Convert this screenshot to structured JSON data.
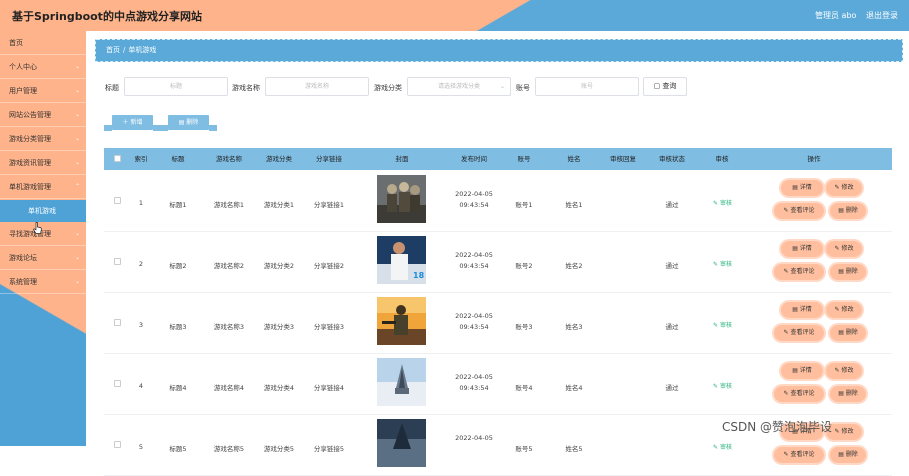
{
  "header": {
    "title": "基于Springboot的中点游戏分享网站",
    "user": "管理员 abo",
    "logout": "退出登录"
  },
  "sidebar": {
    "items": [
      {
        "label": "首页",
        "chevron": ""
      },
      {
        "label": "个人中心",
        "chevron": "⌄"
      },
      {
        "label": "用户管理",
        "chevron": "⌄"
      },
      {
        "label": "网站公告管理",
        "chevron": "⌄"
      },
      {
        "label": "游戏分类管理",
        "chevron": "⌄"
      },
      {
        "label": "游戏资讯管理",
        "chevron": "⌄"
      },
      {
        "label": "单机游戏管理",
        "chevron": "⌃"
      },
      {
        "label": "寻找游戏管理",
        "chevron": "⌄"
      },
      {
        "label": "游戏论坛",
        "chevron": "⌄"
      },
      {
        "label": "系统管理",
        "chevron": "⌄"
      }
    ],
    "active_sub": "单机游戏"
  },
  "breadcrumb": {
    "home": "首页",
    "sep": "/",
    "current": "单机游戏"
  },
  "search": {
    "title_label": "标题",
    "title_placeholder": "标题",
    "name_label": "游戏名称",
    "name_placeholder": "游戏名称",
    "category_label": "游戏分类",
    "category_placeholder": "请选择游戏分类",
    "account_label": "账号",
    "account_placeholder": "账号",
    "button": "查询"
  },
  "actions": {
    "add": "新增",
    "delete": "删除"
  },
  "table": {
    "headers": [
      "索引",
      "标题",
      "游戏名称",
      "游戏分类",
      "分享链接",
      "封面",
      "发布时间",
      "账号",
      "姓名",
      "审核回复",
      "审核状态",
      "审核",
      "操作"
    ],
    "rows": [
      {
        "index": "1",
        "title": "标题1",
        "name": "游戏名称1",
        "category": "游戏分类1",
        "link": "分享链接1",
        "date": "2022-04-05",
        "time": "09:43:54",
        "account": "账号1",
        "person": "姓名1",
        "reply": "",
        "status": "通过"
      },
      {
        "index": "2",
        "title": "标题2",
        "name": "游戏名称2",
        "category": "游戏分类2",
        "link": "分享链接2",
        "date": "2022-04-05",
        "time": "09:43:54",
        "account": "账号2",
        "person": "姓名2",
        "reply": "",
        "status": "通过"
      },
      {
        "index": "3",
        "title": "标题3",
        "name": "游戏名称3",
        "category": "游戏分类3",
        "link": "分享链接3",
        "date": "2022-04-05",
        "time": "09:43:54",
        "account": "账号3",
        "person": "姓名3",
        "reply": "",
        "status": "通过"
      },
      {
        "index": "4",
        "title": "标题4",
        "name": "游戏名称4",
        "category": "游戏分类4",
        "link": "分享链接4",
        "date": "2022-04-05",
        "time": "09:43:54",
        "account": "账号4",
        "person": "姓名4",
        "reply": "",
        "status": "通过"
      },
      {
        "index": "5",
        "title": "标题5",
        "name": "游戏名称5",
        "category": "游戏分类5",
        "link": "分享链接5",
        "date": "2022-04-05",
        "time": "",
        "account": "账号5",
        "person": "姓名5",
        "reply": "",
        "status": ""
      }
    ],
    "audit_label": "审核",
    "op_labels": {
      "detail": "详情",
      "edit": "修改",
      "comments": "查看评论",
      "delete": "删除"
    }
  },
  "watermark": "CSDN @赞泡泡毕设",
  "colors": {
    "header_left": "#ffb38a",
    "header_right": "#5aa9d8",
    "table_head": "#7fbde3",
    "op_button": "#ffbf9e",
    "audit_green": "#29b27b"
  }
}
